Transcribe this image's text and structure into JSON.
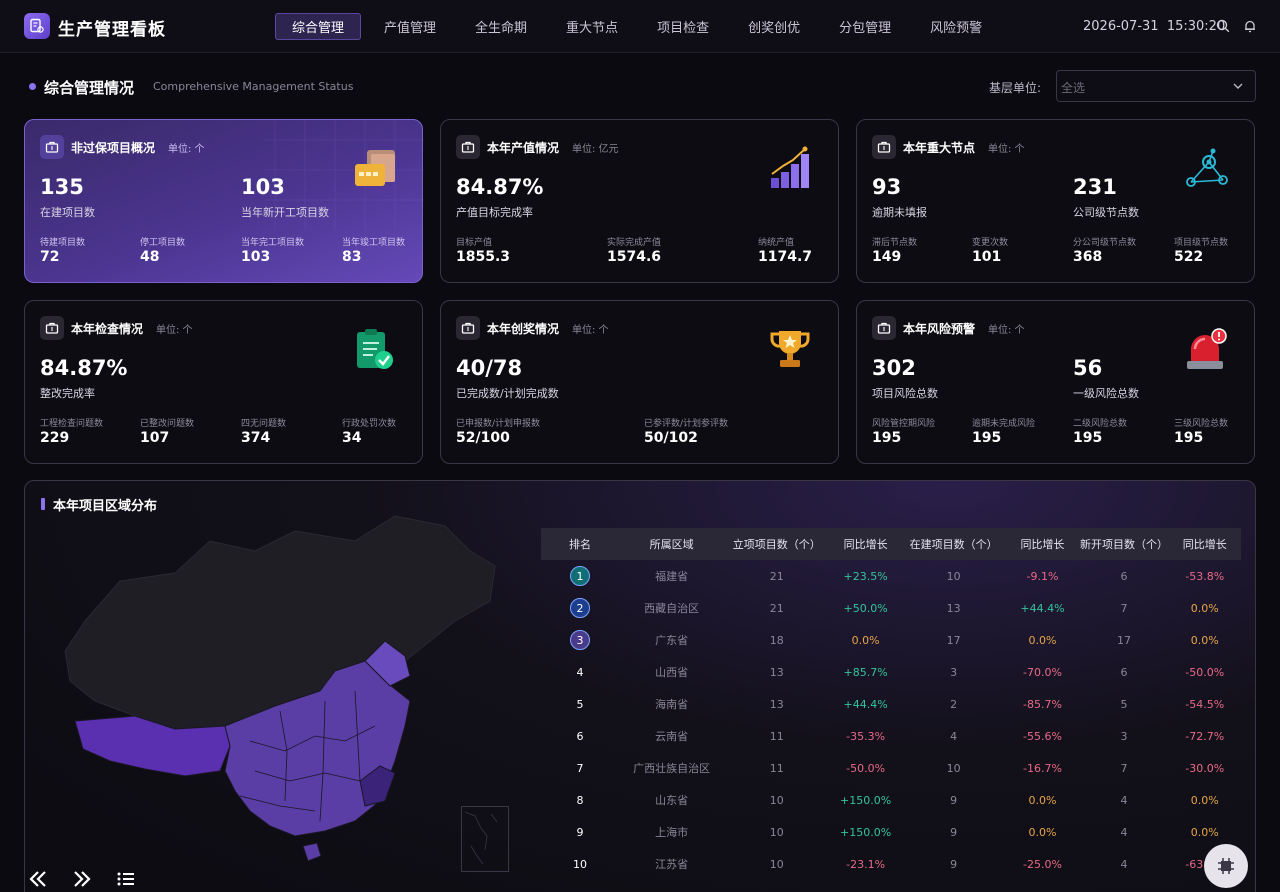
{
  "header": {
    "app_title": "生产管理看板",
    "nav": [
      "综合管理",
      "产值管理",
      "全生命期",
      "重大节点",
      "项目检查",
      "创奖创优",
      "分包管理",
      "风险预警"
    ],
    "active_nav": "综合管理",
    "date": "2026-07-31",
    "time": "15:30:20"
  },
  "section": {
    "title": "综合管理情况",
    "subtitle": "Comprehensive Management Status",
    "unit_label": "基层单位:",
    "unit_placeholder": "全选"
  },
  "cards": {
    "nonguarantee": {
      "title": "非过保项目概况",
      "unit": "单位: 个",
      "big": [
        {
          "value": "135",
          "label": "在建项目数"
        },
        {
          "value": "103",
          "label": "当年新开工项目数"
        }
      ],
      "small": [
        {
          "label": "待建项目数",
          "value": "72"
        },
        {
          "label": "停工项目数",
          "value": "48"
        },
        {
          "label": "当年完工项目数",
          "value": "103"
        },
        {
          "label": "当年竣工项目数",
          "value": "83"
        }
      ]
    },
    "output": {
      "title": "本年产值情况",
      "unit": "单位: 亿元",
      "big": [
        {
          "value": "84.87%",
          "label": "产值目标完成率"
        }
      ],
      "small": [
        {
          "label": "目标产值",
          "value": "1855.3"
        },
        {
          "label": "实际完成产值",
          "value": "1574.6"
        },
        {
          "label": "纳统产值",
          "value": "1174.7"
        }
      ]
    },
    "milestones": {
      "title": "本年重大节点",
      "unit": "单位: 个",
      "big": [
        {
          "value": "93",
          "label": "逾期未填报"
        },
        {
          "value": "231",
          "label": "公司级节点数"
        }
      ],
      "small": [
        {
          "label": "滞后节点数",
          "value": "149"
        },
        {
          "label": "变更次数",
          "value": "101"
        },
        {
          "label": "分公司级节点数",
          "value": "368"
        },
        {
          "label": "项目级节点数",
          "value": "522"
        }
      ]
    },
    "inspection": {
      "title": "本年检查情况",
      "unit": "单位: 个",
      "big": [
        {
          "value": "84.87%",
          "label": "整改完成率"
        }
      ],
      "small": [
        {
          "label": "工程检查问题数",
          "value": "229"
        },
        {
          "label": "已整改问题数",
          "value": "107"
        },
        {
          "label": "四无问题数",
          "value": "374"
        },
        {
          "label": "行政处罚次数",
          "value": "34"
        }
      ]
    },
    "awards": {
      "title": "本年创奖情况",
      "unit": "单位: 个",
      "big": [
        {
          "value": "40/78",
          "label": "已完成数/计划完成数"
        }
      ],
      "small": [
        {
          "label": "已申报数/计划申报数",
          "value": "52/100"
        },
        {
          "label": "已参评数/计划参评数",
          "value": "50/102"
        }
      ]
    },
    "risk": {
      "title": "本年风险预警",
      "unit": "单位: 个",
      "big": [
        {
          "value": "302",
          "label": "项目风险总数"
        },
        {
          "value": "56",
          "label": "一级风险总数"
        }
      ],
      "small": [
        {
          "label": "风险管控期风险",
          "value": "195"
        },
        {
          "label": "逾期未完成风险",
          "value": "195"
        },
        {
          "label": "二级风险总数",
          "value": "195"
        },
        {
          "label": "三级风险总数",
          "value": "195"
        }
      ]
    }
  },
  "region": {
    "title": "本年项目区域分布",
    "columns": [
      "排名",
      "所属区域",
      "立项项目数（个）",
      "同比增长",
      "在建项目数（个）",
      "同比增长",
      "新开项目数（个）",
      "同比增长"
    ],
    "rows": [
      {
        "rank": "1",
        "region": "福建省",
        "a": "21",
        "ag": "+23.5%",
        "b": "10",
        "bg": "-9.1%",
        "c": "6",
        "cg": "-53.8%"
      },
      {
        "rank": "2",
        "region": "西藏自治区",
        "a": "21",
        "ag": "+50.0%",
        "b": "13",
        "bg": "+44.4%",
        "c": "7",
        "cg": "0.0%"
      },
      {
        "rank": "3",
        "region": "广东省",
        "a": "18",
        "ag": "0.0%",
        "b": "17",
        "bg": "0.0%",
        "c": "17",
        "cg": "0.0%"
      },
      {
        "rank": "4",
        "region": "山西省",
        "a": "13",
        "ag": "+85.7%",
        "b": "3",
        "bg": "-70.0%",
        "c": "6",
        "cg": "-50.0%"
      },
      {
        "rank": "5",
        "region": "海南省",
        "a": "13",
        "ag": "+44.4%",
        "b": "2",
        "bg": "-85.7%",
        "c": "5",
        "cg": "-54.5%"
      },
      {
        "rank": "6",
        "region": "云南省",
        "a": "11",
        "ag": "-35.3%",
        "b": "4",
        "bg": "-55.6%",
        "c": "3",
        "cg": "-72.7%"
      },
      {
        "rank": "7",
        "region": "广西壮族自治区",
        "a": "11",
        "ag": "-50.0%",
        "b": "10",
        "bg": "-16.7%",
        "c": "7",
        "cg": "-30.0%"
      },
      {
        "rank": "8",
        "region": "山东省",
        "a": "10",
        "ag": "+150.0%",
        "b": "9",
        "bg": "0.0%",
        "c": "4",
        "cg": "0.0%"
      },
      {
        "rank": "9",
        "region": "上海市",
        "a": "10",
        "ag": "+150.0%",
        "b": "9",
        "bg": "0.0%",
        "c": "4",
        "cg": "0.0%"
      },
      {
        "rank": "10",
        "region": "江苏省",
        "a": "10",
        "ag": "-23.1%",
        "b": "9",
        "bg": "-25.0%",
        "c": "4",
        "cg": "-63.6%"
      }
    ]
  },
  "colors": {
    "accent": "#8c73f0",
    "positive": "#36c49a",
    "negative": "#e86a86",
    "neutral": "#e6a54a",
    "map_fill": "#5a3aa8",
    "map_land": "#1f1e25"
  }
}
